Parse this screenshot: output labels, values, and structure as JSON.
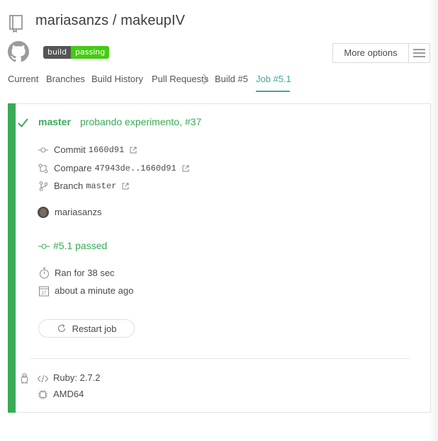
{
  "header": {
    "owner": "mariasanzs",
    "separator": " / ",
    "repo": "makeupIV",
    "badge": {
      "left": "build",
      "right": "passing",
      "left_color": "#555555",
      "right_color": "#44cc11"
    },
    "more_options_label": "More options"
  },
  "nav": {
    "tabs": [
      "Current",
      "Branches",
      "Build History",
      "Pull Requests",
      "Build #5",
      "Job #5.1"
    ],
    "active_tab": "Job #5.1"
  },
  "job": {
    "status_color": "#39aa56",
    "branch": "master",
    "commit_message": "probando experimento, #37",
    "commit_label": "Commit",
    "commit_sha": "1660d91",
    "compare_label": "Compare",
    "compare_range": "47943de..1660d91",
    "branch_label": "Branch",
    "branch_value": "master",
    "author": "mariasanzs",
    "job_status": "#5.1 passed",
    "duration": "Ran for 38 sec",
    "finished": "about a minute ago",
    "restart_label": "Restart job",
    "calendar_day": "27"
  },
  "environment": {
    "os_icon": "linux-icon",
    "language": "Ruby: 2.7.2",
    "arch": "AMD64"
  }
}
